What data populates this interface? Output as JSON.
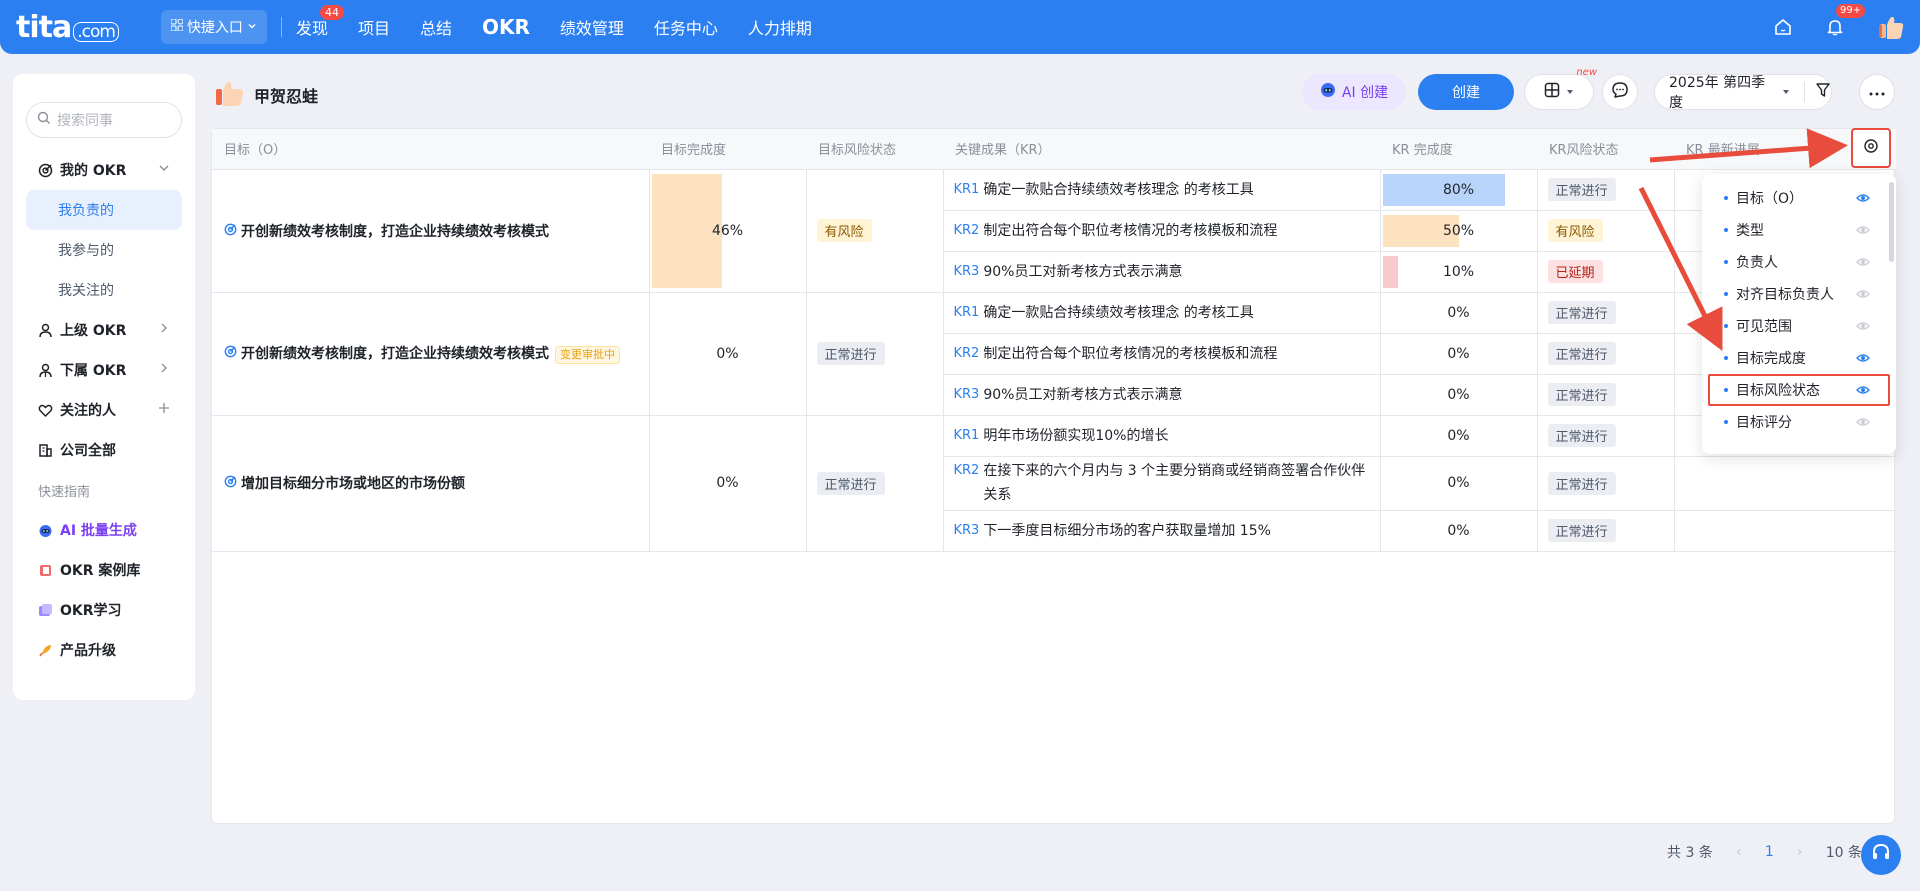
{
  "topnav": {
    "logo": "tita",
    "logo_domain": ".com",
    "quick_entry": "快捷入口",
    "items": [
      {
        "label": "发现",
        "badge": "44"
      },
      {
        "label": "项目"
      },
      {
        "label": "总结"
      },
      {
        "label": "OKR"
      },
      {
        "label": "绩效管理"
      },
      {
        "label": "任务中心"
      },
      {
        "label": "人力排期"
      }
    ],
    "notification_badge": "99+"
  },
  "sidebar": {
    "search_placeholder": "搜索同事",
    "my_okr": "我的 OKR",
    "my_okr_subs": [
      "我负责的",
      "我参与的",
      "我关注的"
    ],
    "superior_okr": "上级 OKR",
    "subordinate_okr": "下属 OKR",
    "followed_people": "关注的人",
    "company_all": "公司全部",
    "quick_guide": "快速指南",
    "tools": [
      "AI 批量生成",
      "OKR 案例库",
      "OKR学习",
      "产品升级"
    ]
  },
  "header": {
    "owner_name": "甲贺忍蛙",
    "ai_create": "AI 创建",
    "create": "创建",
    "new_tag": "new",
    "period": "2025年 第四季度"
  },
  "table": {
    "columns": [
      "目标（O）",
      "目标完成度",
      "目标风险状态",
      "关键成果（KR）",
      "KR 完成度",
      "KR风险状态",
      "KR 最新进展"
    ],
    "objectives": [
      {
        "title": "开创新绩效考核制度，打造企业持续绩效考核模式",
        "tag": "",
        "progress": "46%",
        "progress_value": 46,
        "risk": "有风险",
        "risk_type": "risk",
        "krs": [
          {
            "code": "KR1",
            "text": "确定一款贴合持续绩效考核理念 的考核工具",
            "progress": "80%",
            "progress_value": 80,
            "status": "正常进行",
            "status_type": "normal"
          },
          {
            "code": "KR2",
            "text": "制定出符合每个职位考核情况的考核模板和流程",
            "progress": "50%",
            "progress_value": 50,
            "status": "有风险",
            "status_type": "risk"
          },
          {
            "code": "KR3",
            "text": "90%员工对新考核方式表示满意",
            "progress": "10%",
            "progress_value": 10,
            "status": "已延期",
            "status_type": "delay"
          }
        ]
      },
      {
        "title": "开创新绩效考核制度，打造企业持续绩效考核模式",
        "tag": "变更审批中",
        "progress": "0%",
        "progress_value": 0,
        "risk": "正常进行",
        "risk_type": "normal",
        "krs": [
          {
            "code": "KR1",
            "text": "确定一款贴合持续绩效考核理念 的考核工具",
            "progress": "0%",
            "progress_value": 0,
            "status": "正常进行",
            "status_type": "normal"
          },
          {
            "code": "KR2",
            "text": "制定出符合每个职位考核情况的考核模板和流程",
            "progress": "0%",
            "progress_value": 0,
            "status": "正常进行",
            "status_type": "normal"
          },
          {
            "code": "KR3",
            "text": "90%员工对新考核方式表示满意",
            "progress": "0%",
            "progress_value": 0,
            "status": "正常进行",
            "status_type": "normal"
          }
        ]
      },
      {
        "title": "增加目标细分市场或地区的市场份额",
        "tag": "",
        "progress": "0%",
        "progress_value": 0,
        "risk": "正常进行",
        "risk_type": "normal",
        "krs": [
          {
            "code": "KR1",
            "text": "明年市场份额实现10%的增长",
            "progress": "0%",
            "progress_value": 0,
            "status": "正常进行",
            "status_type": "normal"
          },
          {
            "code": "KR2",
            "text": "在接下来的六个月内与 3 个主要分销商或经销商签署合作伙伴关系",
            "progress": "0%",
            "progress_value": 0,
            "status": "正常进行",
            "status_type": "normal"
          },
          {
            "code": "KR3",
            "text": "下一季度目标细分市场的客户获取量增加 15%",
            "progress": "0%",
            "progress_value": 0,
            "status": "正常进行",
            "status_type": "normal"
          }
        ]
      }
    ]
  },
  "column_panel": {
    "items": [
      {
        "label": "目标（O）",
        "visible": true
      },
      {
        "label": "类型",
        "visible": false
      },
      {
        "label": "负责人",
        "visible": false
      },
      {
        "label": "对齐目标负责人",
        "visible": false
      },
      {
        "label": "可见范围",
        "visible": false
      },
      {
        "label": "目标完成度",
        "visible": true
      },
      {
        "label": "目标风险状态",
        "visible": true,
        "highlighted": true
      },
      {
        "label": "目标评分",
        "visible": false
      }
    ]
  },
  "pager": {
    "total": "共 3 条",
    "current": "1",
    "page_size": "10 条/"
  },
  "colors": {
    "primary": "#2b7ff0",
    "annotation_red": "#e74c3c",
    "bar_risk": "#fde2bf",
    "bar_normal": "#b9d4fb",
    "bar_delay": "#f9c9cc"
  }
}
